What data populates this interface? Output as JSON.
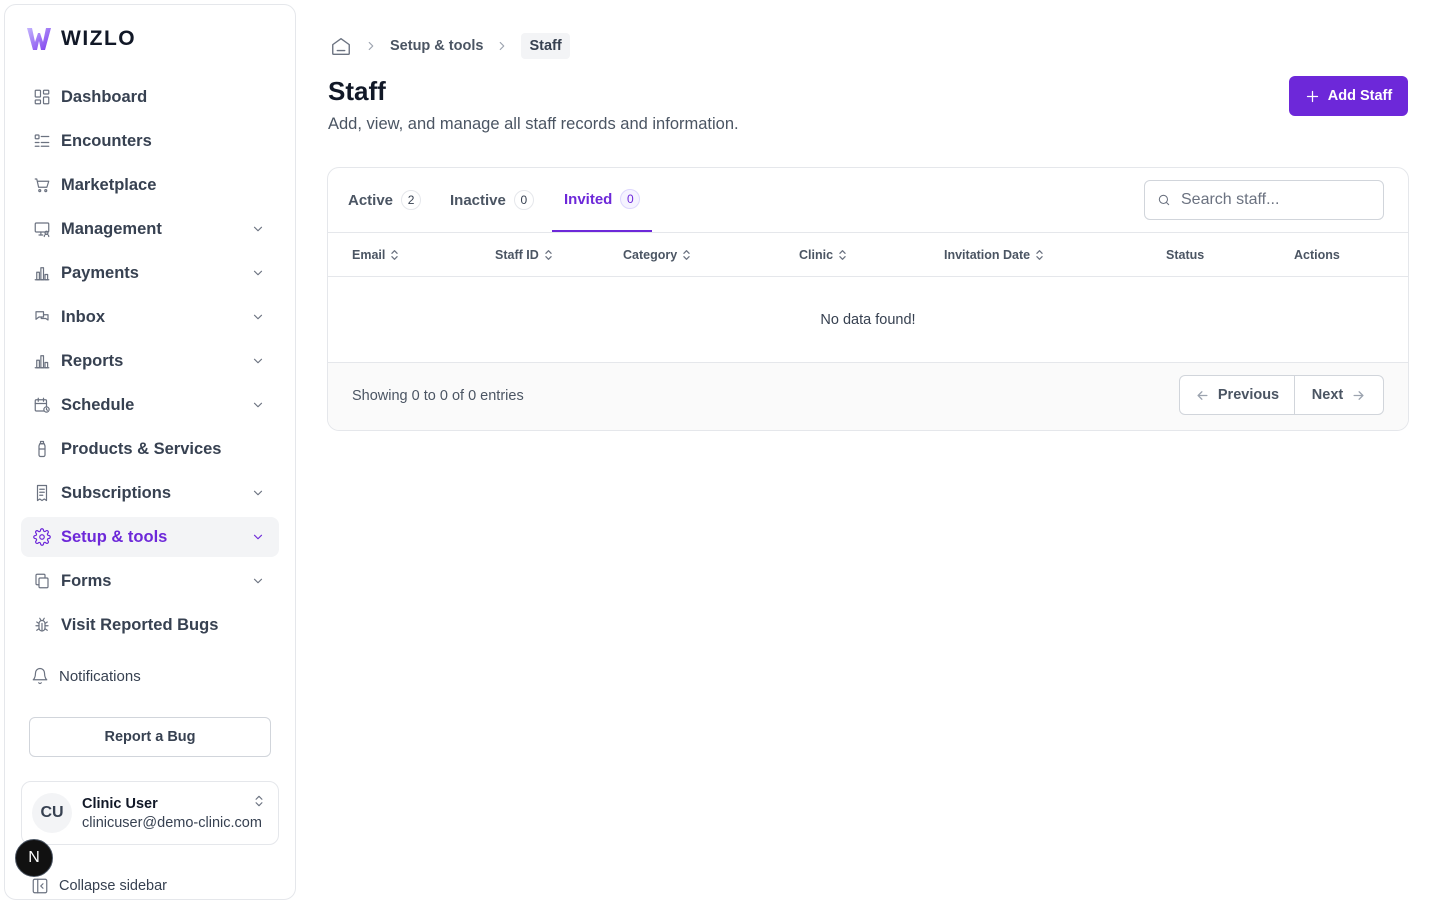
{
  "app": {
    "brand": "WIZLO",
    "brand_color": "#6d28d9"
  },
  "sidebar": {
    "items": [
      {
        "label": "Dashboard",
        "icon": "dashboard-icon",
        "has_chevron": false
      },
      {
        "label": "Encounters",
        "icon": "list-icon",
        "has_chevron": false
      },
      {
        "label": "Marketplace",
        "icon": "cart-icon",
        "has_chevron": false
      },
      {
        "label": "Management",
        "icon": "monitor-user-icon",
        "has_chevron": true
      },
      {
        "label": "Payments",
        "icon": "bar-chart-icon",
        "has_chevron": true
      },
      {
        "label": "Inbox",
        "icon": "chat-icon",
        "has_chevron": true
      },
      {
        "label": "Reports",
        "icon": "bar-chart-icon",
        "has_chevron": true
      },
      {
        "label": "Schedule",
        "icon": "calendar-clock-icon",
        "has_chevron": true
      },
      {
        "label": "Products & Services",
        "icon": "bottle-icon",
        "has_chevron": false
      },
      {
        "label": "Subscriptions",
        "icon": "receipt-icon",
        "has_chevron": true
      },
      {
        "label": "Setup & tools",
        "icon": "gear-icon",
        "has_chevron": true,
        "active": true
      },
      {
        "label": "Forms",
        "icon": "copy-icon",
        "has_chevron": true
      },
      {
        "label": "Visit Reported Bugs",
        "icon": "bug-icon",
        "has_chevron": false
      }
    ],
    "notifications_label": "Notifications",
    "report_bug_label": "Report a Bug",
    "user": {
      "initials": "CU",
      "name": "Clinic User",
      "email": "clinicuser@demo-clinic.com"
    },
    "dev_badge": "N",
    "collapse_label": "Collapse sidebar"
  },
  "breadcrumb": {
    "parent": "Setup & tools",
    "current": "Staff"
  },
  "header": {
    "title": "Staff",
    "subtitle": "Add, view, and manage all staff records and information.",
    "add_label": "Add Staff"
  },
  "tabs": [
    {
      "label": "Active",
      "count": "2"
    },
    {
      "label": "Inactive",
      "count": "0"
    },
    {
      "label": "Invited",
      "count": "0",
      "active": true
    }
  ],
  "search": {
    "placeholder": "Search staff...",
    "value": ""
  },
  "table": {
    "columns": [
      {
        "label": "Email",
        "sortable": true
      },
      {
        "label": "Staff ID",
        "sortable": true
      },
      {
        "label": "Category",
        "sortable": true
      },
      {
        "label": "Clinic",
        "sortable": true
      },
      {
        "label": "Invitation Date",
        "sortable": true
      },
      {
        "label": "Status",
        "sortable": false
      },
      {
        "label": "Actions",
        "sortable": false
      }
    ],
    "rows": [],
    "empty_text": "No data found!"
  },
  "pagination": {
    "showing": "Showing 0 to 0 of 0 entries",
    "previous": "Previous",
    "next": "Next"
  }
}
